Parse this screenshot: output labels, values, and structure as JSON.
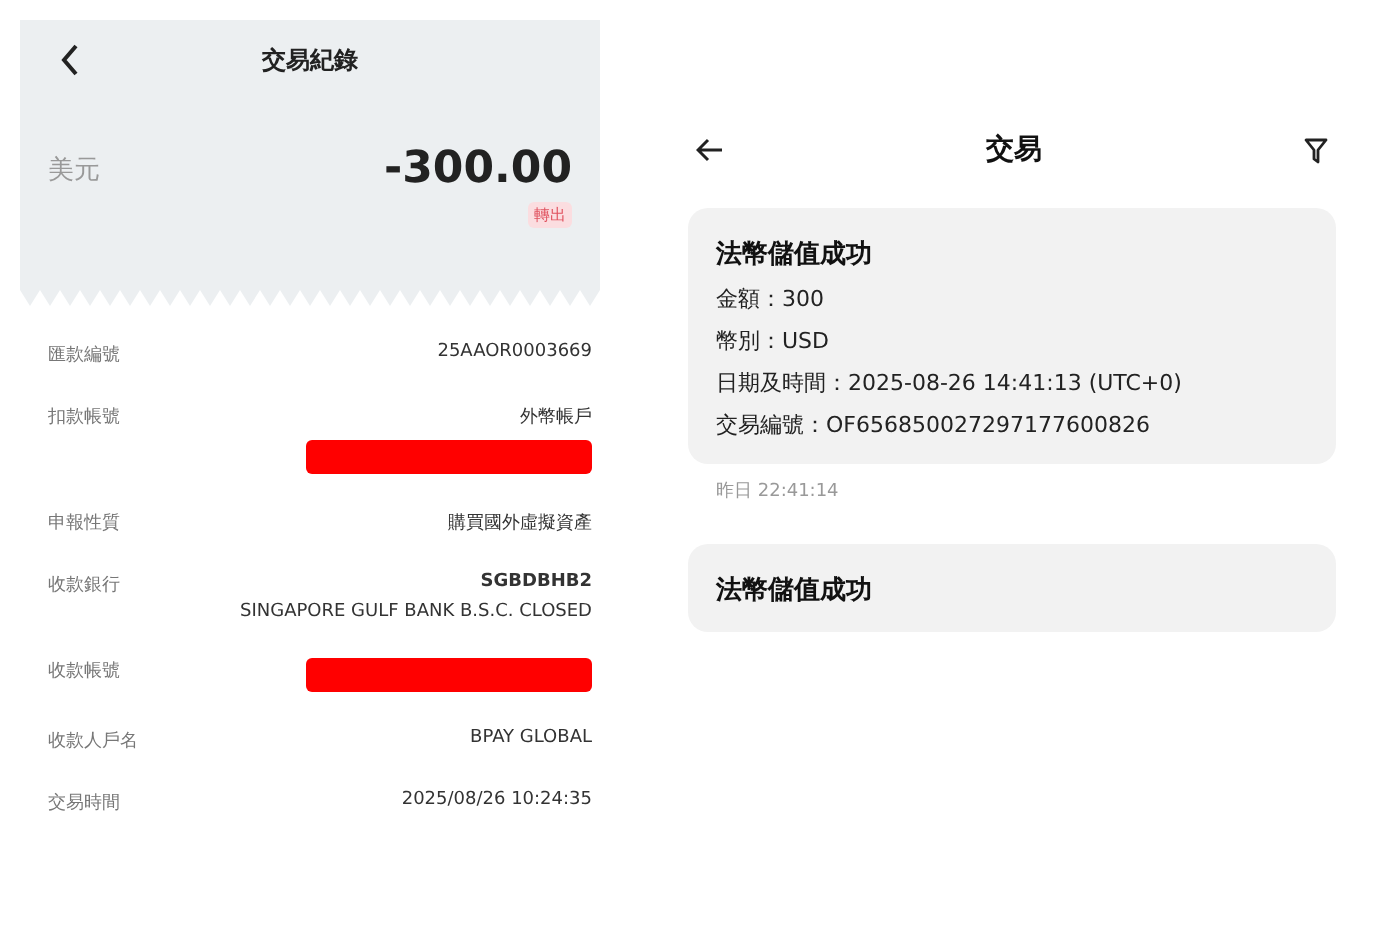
{
  "left_screen": {
    "title": "交易紀錄",
    "currency": "美元",
    "amount": "-300.00",
    "badge": "轉出",
    "rows": [
      {
        "label": "匯款編號",
        "values": [
          "25AAOR0003669"
        ],
        "redacted": false
      },
      {
        "label": "扣款帳號",
        "values": [
          "外幣帳戶"
        ],
        "redacted": true
      },
      {
        "label": "申報性質",
        "values": [
          "購買國外虛擬資產"
        ],
        "redacted": false
      },
      {
        "label": "收款銀行",
        "values": [
          "SGBDBHB2",
          "SINGAPORE GULF BANK B.S.C. CLOSED"
        ],
        "redacted": false
      },
      {
        "label": "收款帳號",
        "redacted": true
      },
      {
        "label": "收款人戶名",
        "values": [
          "BPAY GLOBAL"
        ],
        "redacted": false
      },
      {
        "label": "交易時間",
        "values": [
          "2025/08/26 10:24:35"
        ],
        "redacted": false
      }
    ]
  },
  "right_screen": {
    "title": "交易",
    "cards": [
      {
        "title": "法幣儲值成功",
        "lines": [
          "金額：300",
          "幣別：USD",
          "日期及時間：2025-08-26 14:41:13 (UTC+0)",
          "交易編號：OF656850027297177600826"
        ],
        "time": "昨日 22:41:14"
      },
      {
        "title": "法幣儲值成功"
      }
    ]
  }
}
